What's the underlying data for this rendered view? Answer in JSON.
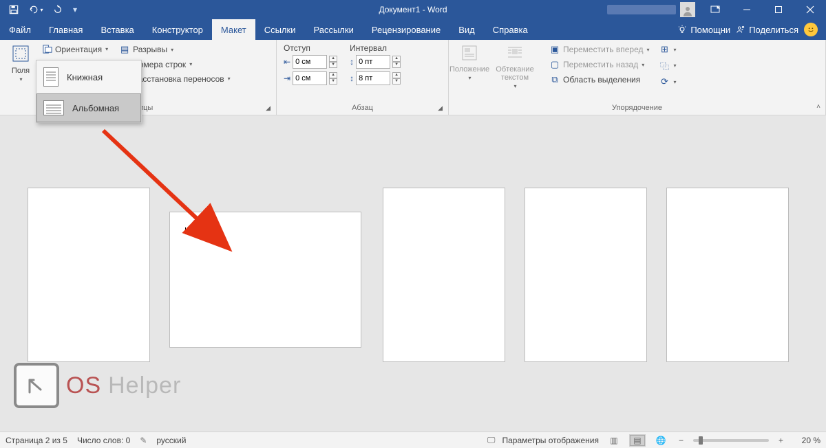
{
  "title": "Документ1 - Word",
  "tabs": {
    "file": "Файл",
    "home": "Главная",
    "insert": "Вставка",
    "design": "Конструктор",
    "layout": "Макет",
    "references": "Ссылки",
    "mailings": "Рассылки",
    "review": "Рецензирование",
    "view": "Вид",
    "help": "Справка",
    "tellme": "Помощни",
    "share": "Поделиться"
  },
  "ribbon": {
    "margins": "Поля",
    "orientation": "Ориентация",
    "orientation_portrait": "Книжная",
    "orientation_landscape": "Альбомная",
    "breaks": "Разрывы",
    "linenumbers": "Номера строк",
    "hyphenation": "Расстановка переносов",
    "pagesetup_label": "траницы",
    "indent_title": "Отступ",
    "spacing_title": "Интервал",
    "indent_left": "0 см",
    "indent_right": "0 см",
    "spacing_before": "0 пт",
    "spacing_after": "8 пт",
    "paragraph_label": "Абзац",
    "position": "Положение",
    "wrap": "Обтекание текстом",
    "bring_forward": "Переместить вперед",
    "send_backward": "Переместить назад",
    "selection_pane": "Область выделения",
    "arrange_label": "Упорядочение"
  },
  "status": {
    "page": "Страница 2 из 5",
    "words": "Число слов: 0",
    "lang": "русский",
    "display_settings": "Параметры отображения",
    "zoom": "20 %"
  },
  "watermark": {
    "os": "OS",
    "helper": "Helper"
  }
}
